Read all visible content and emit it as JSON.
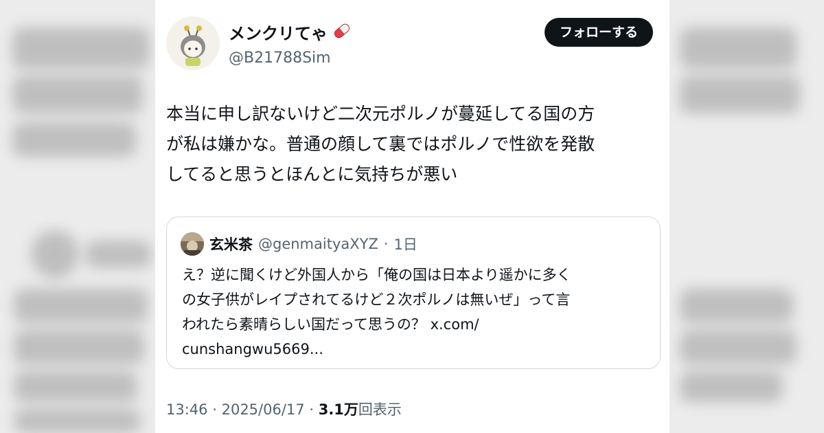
{
  "author": {
    "display_name": "メンクリてゃ",
    "handle": "@B21788Sim",
    "name_emoji": "pill-icon"
  },
  "follow_button_label": "フォローする",
  "tweet_text": "本当に申し訳ないけど二次元ポルノが蔓延してる国の方\nが私は嫌かな。普通の顔して裏ではポルノで性欲を発散\nしてると思うとほんとに気持ちが悪い",
  "quoted": {
    "display_name": "玄米茶",
    "handle": "@genmaityaXYZ",
    "separator": "·",
    "time": "1日",
    "text": "え？逆に聞くけど外国人から「俺の国は日本より遥かに多く\nの女子供がレイプされてるけど２次ポルノは無いぜ」って言\nわれたら素晴らしい国だって思うの？ x.com/\ncunshangwu5669..."
  },
  "footer": {
    "time": "13:46",
    "dot1": "·",
    "date": "2025/06/17",
    "dot2": "·",
    "views_count": "3.1万",
    "views_label": "回表示"
  },
  "colors": {
    "text_primary": "#0f1419",
    "text_secondary": "#536471",
    "border": "#cfd9de",
    "button_bg": "#0f1419"
  }
}
